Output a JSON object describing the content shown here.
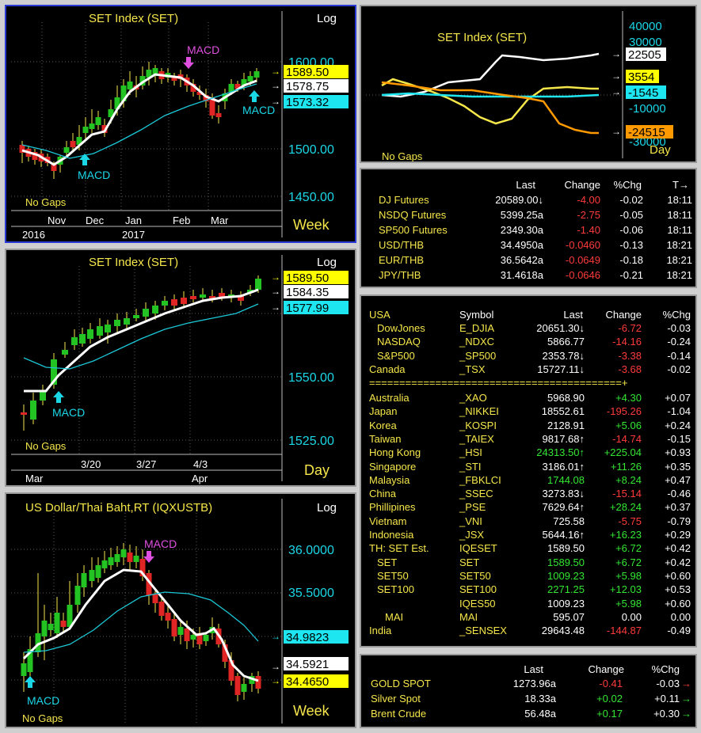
{
  "colors": {
    "up": "#22c322",
    "down": "#e02525",
    "ma_fast": "#ffffff",
    "ma_slow": "#1bc7d6",
    "title": "#f5e64a",
    "cyan": "#1bd7e6",
    "magenta": "#e050e0"
  },
  "panel1": {
    "title": "SET Index (SET)",
    "scale": "Log",
    "period": "Week",
    "no_gaps": "No Gaps",
    "macd_top": "MACD",
    "macd_low1": "MACD",
    "macd_low2": "MACD",
    "price_labels": [
      {
        "text": "1589.50",
        "style": "yellow"
      },
      {
        "text": "1578.75",
        "style": "white"
      },
      {
        "text": "1573.32",
        "style": "cyan"
      }
    ],
    "y_ticks": [
      "1600.00",
      "1500.00",
      "1450.00"
    ],
    "months": [
      "Nov",
      "Dec",
      "Jan",
      "Feb",
      "Mar"
    ],
    "years": [
      "2016",
      "2017"
    ]
  },
  "panel2": {
    "title": "SET Index (SET)",
    "scale": "Log",
    "period": "Day",
    "no_gaps": "No Gaps",
    "macd": "MACD",
    "price_labels": [
      {
        "text": "1589.50",
        "style": "yellow"
      },
      {
        "text": "1584.35",
        "style": "white"
      },
      {
        "text": "1577.99",
        "style": "cyan"
      }
    ],
    "y_ticks": [
      "1550.00",
      "1525.00"
    ],
    "dates": [
      "3/20",
      "3/27",
      "4/3"
    ],
    "months": [
      "Mar",
      "Apr"
    ]
  },
  "panel3": {
    "title": "US Dollar/Thai Baht,RT (IQXUSTB)",
    "scale": "Log",
    "period": "Week",
    "no_gaps": "No Gaps",
    "macd_top": "MACD",
    "macd_low": "MACD",
    "y_ticks": [
      "36.0000",
      "35.5000"
    ],
    "price_labels": [
      {
        "text": "34.9823",
        "style": "cyan"
      },
      {
        "text": "34.5921",
        "style": "white"
      },
      {
        "text": "34.4650",
        "style": "yellow"
      }
    ]
  },
  "panel4": {
    "title": "SET Index (SET)",
    "no_gaps": "No Gaps",
    "period": "Day",
    "y_ticks": [
      "40000",
      "30000",
      "-10000",
      "-30000"
    ],
    "labels": [
      {
        "text": "22505",
        "style": "white"
      },
      {
        "text": "3554",
        "style": "yellow"
      },
      {
        "text": "-1545",
        "style": "cyan"
      },
      {
        "text": "-24515",
        "style": "orange"
      }
    ]
  },
  "futures": {
    "headers": [
      "Last",
      "Change",
      "%Chg",
      "T"
    ],
    "rows": [
      {
        "name": "DJ Futures",
        "last": "20589.00↓",
        "change": "-4.00",
        "pct": "-0.02",
        "time": "18:11"
      },
      {
        "name": "NSDQ Futures",
        "last": "5399.25a",
        "change": "-2.75",
        "pct": "-0.05",
        "time": "18:11"
      },
      {
        "name": "SP500 Futures",
        "last": "2349.30a",
        "change": "-1.40",
        "pct": "-0.06",
        "time": "18:11"
      },
      {
        "name": "USD/THB",
        "last": "34.4950a",
        "change": "-0.0460",
        "pct": "-0.13",
        "time": "18:21"
      },
      {
        "name": "EUR/THB",
        "last": "36.5642a",
        "change": "-0.0649",
        "pct": "-0.18",
        "time": "18:21"
      },
      {
        "name": "JPY/THB",
        "last": "31.4618a",
        "change": "-0.0646",
        "pct": "-0.21",
        "time": "18:21"
      }
    ]
  },
  "markets": {
    "headers": [
      "USA",
      "Symbol",
      "Last",
      "Change",
      "%Chg"
    ],
    "separator": "==========================================+",
    "usa": [
      {
        "name": "DowJones",
        "symbol": "E_DJIA",
        "last": "20651.30↓",
        "change": "-6.72",
        "pct": "-0.03",
        "c": "r",
        "lc": "w"
      },
      {
        "name": "NASDAQ",
        "symbol": "_NDXC",
        "last": "5866.77",
        "change": "-14.16",
        "pct": "-0.24",
        "c": "r",
        "lc": "w"
      },
      {
        "name": "S&P500",
        "symbol": "_SP500",
        "last": "2353.78↓",
        "change": "-3.38",
        "pct": "-0.14",
        "c": "r",
        "lc": "w"
      },
      {
        "name": "Canada",
        "symbol": "_TSX",
        "last": "15727.11↓",
        "change": "-3.68",
        "pct": "-0.02",
        "c": "r",
        "lc": "w"
      }
    ],
    "asia": [
      {
        "name": "Australia",
        "symbol": "_XAO",
        "last": "5968.90",
        "change": "+4.30",
        "pct": "+0.07",
        "c": "g",
        "lc": "w"
      },
      {
        "name": "Japan",
        "symbol": "_NIKKEI",
        "last": "18552.61",
        "change": "-195.26",
        "pct": "-1.04",
        "c": "r",
        "lc": "w"
      },
      {
        "name": "Korea",
        "symbol": "_KOSPI",
        "last": "2128.91",
        "change": "+5.06",
        "pct": "+0.24",
        "c": "g",
        "lc": "w"
      },
      {
        "name": "Taiwan",
        "symbol": "_TAIEX",
        "last": "9817.68↑",
        "change": "-14.74",
        "pct": "-0.15",
        "c": "r",
        "lc": "w"
      },
      {
        "name": "Hong Kong",
        "symbol": "_HSI",
        "last": "24313.50↑",
        "change": "+225.04",
        "pct": "+0.93",
        "c": "g",
        "lc": "g"
      },
      {
        "name": "Singapore",
        "symbol": "_STI",
        "last": "3186.01↑",
        "change": "+11.26",
        "pct": "+0.35",
        "c": "g",
        "lc": "w"
      },
      {
        "name": "Malaysia",
        "symbol": "_FBKLCI",
        "last": "1744.08",
        "change": "+8.24",
        "pct": "+0.47",
        "c": "g",
        "lc": "g"
      },
      {
        "name": "China",
        "symbol": "_SSEC",
        "last": "3273.83↓",
        "change": "-15.14",
        "pct": "-0.46",
        "c": "r",
        "lc": "w"
      },
      {
        "name": "Phillipines",
        "symbol": "_PSE",
        "last": "7629.64↑",
        "change": "+28.24",
        "pct": "+0.37",
        "c": "g",
        "lc": "w"
      },
      {
        "name": "Vietnam",
        "symbol": "_VNI",
        "last": "725.58",
        "change": "-5.75",
        "pct": "-0.79",
        "c": "r",
        "lc": "w"
      },
      {
        "name": "Indonesia",
        "symbol": "_JSX",
        "last": "5644.16↑",
        "change": "+16.23",
        "pct": "+0.29",
        "c": "g",
        "lc": "w"
      },
      {
        "name": "TH: SET Est.",
        "symbol": "IQESET",
        "last": "1589.50",
        "change": "+6.72",
        "pct": "+0.42",
        "c": "g",
        "lc": "w"
      },
      {
        "name": "SET",
        "symbol": "SET",
        "last": "1589.50",
        "change": "+6.72",
        "pct": "+0.42",
        "c": "g",
        "lc": "g",
        "indent": 1
      },
      {
        "name": "SET50",
        "symbol": "SET50",
        "last": "1009.23",
        "change": "+5.98",
        "pct": "+0.60",
        "c": "g",
        "lc": "g",
        "indent": 1
      },
      {
        "name": "SET100",
        "symbol": "SET100",
        "last": "2271.25",
        "change": "+12.03",
        "pct": "+0.53",
        "c": "g",
        "lc": "g",
        "indent": 1
      },
      {
        "name": "",
        "symbol": "IQES50",
        "last": "1009.23",
        "change": "+5.98",
        "pct": "+0.60",
        "c": "g",
        "lc": "w"
      },
      {
        "name": "MAI",
        "symbol": "MAI",
        "last": "595.07",
        "change": "0.00",
        "pct": "0.00",
        "c": "w",
        "lc": "w",
        "indent": 2
      },
      {
        "name": "India",
        "symbol": "_SENSEX",
        "last": "29643.48",
        "change": "-144.87",
        "pct": "-0.49",
        "c": "r",
        "lc": "w"
      }
    ]
  },
  "commodities": {
    "headers": [
      "Last",
      "Change",
      "%Chg"
    ],
    "rows": [
      {
        "name": "GOLD SPOT",
        "last": "1273.96a",
        "change": "-0.41",
        "pct": "-0.03",
        "c": "r"
      },
      {
        "name": "Silver Spot",
        "last": "18.33a",
        "change": "+0.02",
        "pct": "+0.11",
        "c": "g"
      },
      {
        "name": "Brent Crude",
        "last": "56.48a",
        "change": "+0.17",
        "pct": "+0.30",
        "c": "g"
      }
    ]
  }
}
